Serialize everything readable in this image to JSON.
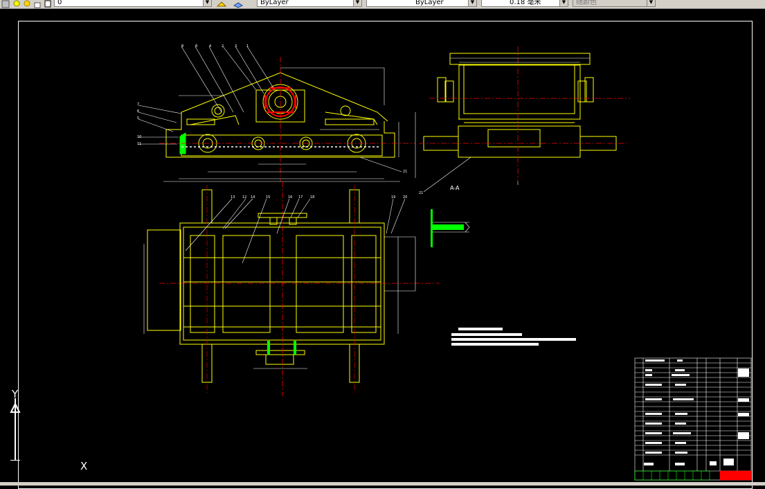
{
  "toolbar": {
    "layer_name": "0",
    "color_value": "ByLayer",
    "linetype_value": "ByLayer",
    "lineweight_value": "0.18 毫米",
    "plotstyle_value": "随颜色"
  },
  "ucs": {
    "x_label": "X",
    "y_label": "Y"
  },
  "section_label": "A-A",
  "colors": {
    "background": "#000000",
    "part_outline": "#ffff00",
    "center_line": "#ff0000",
    "weld_highlight": "#00ff00",
    "leader_line": "#ffffff"
  }
}
